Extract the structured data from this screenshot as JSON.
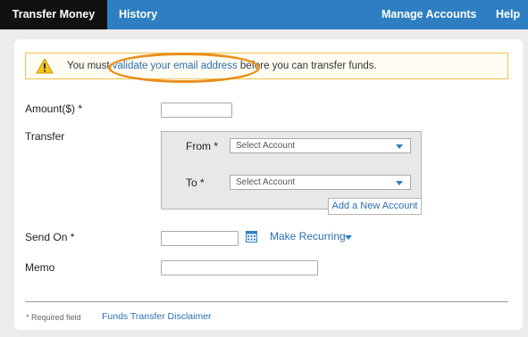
{
  "nav": {
    "tabs": [
      {
        "label": "Transfer Money"
      },
      {
        "label": "History"
      },
      {
        "label": "Manage Accounts"
      },
      {
        "label": "Help"
      }
    ]
  },
  "alert": {
    "prefix": "You must ",
    "link": "validate your email address",
    "suffix": " before you can transfer funds."
  },
  "form": {
    "amount_label": "Amount($) *",
    "transfer_label": "Transfer",
    "from_label": "From *",
    "to_label": "To *",
    "from_select": "Select Account",
    "to_select": "Select Account",
    "add_account": "Add a New Account",
    "send_on_label": "Send On *",
    "make_recurring": "Make Recurring",
    "memo_label": "Memo"
  },
  "footer": {
    "required_note": "* Required field",
    "disclaimer": "Funds Transfer Disclaimer"
  },
  "colors": {
    "nav_bg": "#2e7fc1",
    "active_tab_bg": "#111111",
    "link": "#2b6fb0",
    "alert_border": "#f0c24c",
    "highlight_ring": "#e8901c"
  }
}
